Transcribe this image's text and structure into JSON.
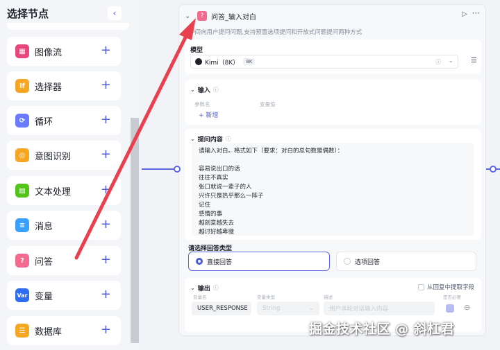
{
  "sidebar": {
    "title": "选择节点",
    "collapse_icon": "chevron-left-icon",
    "items": [
      {
        "label": "图像流",
        "icon": "grid-icon",
        "color": "#e8467c"
      },
      {
        "label": "选择器",
        "icon": "if-icon",
        "color": "#f5a623"
      },
      {
        "label": "循环",
        "icon": "loop-icon",
        "color": "#6b7bff"
      },
      {
        "label": "意图识别",
        "icon": "intent-icon",
        "color": "#f5a623"
      },
      {
        "label": "文本处理",
        "icon": "text-process-icon",
        "color": "#52c41a"
      },
      {
        "label": "消息",
        "icon": "message-icon",
        "color": "#3aa0ff"
      },
      {
        "label": "问答",
        "icon": "question-icon",
        "color": "#f26a8d"
      },
      {
        "label": "变量",
        "icon": "var-icon",
        "color": "#2f6df0"
      },
      {
        "label": "数据库",
        "icon": "database-icon",
        "color": "#f5a623"
      }
    ],
    "add_symbol": "+"
  },
  "node": {
    "title": "问答_输入对白",
    "description": "中间向用户提问问题,支持预置选项提问和开放式问题提问两种方式",
    "model": {
      "label": "模型",
      "name": "Kimi（8K）",
      "tag": "8K"
    },
    "input": {
      "label": "输入",
      "col_name": "参数名",
      "col_value": "变量值",
      "add_label": "+ 新增"
    },
    "prompt": {
      "label": "提问内容",
      "lines": [
        "请输入对白。格式如下（要求：对白的总句数是偶数）：",
        "",
        "容易说出口的话",
        "往往不真实",
        "张口就说一辈子的人",
        "兴许只是热乎那么一阵子",
        "记住",
        "感情的事",
        "越刻意越失去",
        "越讨好越卑微"
      ]
    },
    "answer_type": {
      "label": "请选择回答类型",
      "options": [
        {
          "label": "直接回答",
          "selected": true
        },
        {
          "label": "选项回答",
          "selected": false
        }
      ]
    },
    "output": {
      "label": "输出",
      "extract_label": "从回复中提取字段",
      "col_var": "变量名",
      "col_type": "变量类型",
      "col_desc": "描述",
      "col_required": "是否必要",
      "var_name": "USER_RESPONSE",
      "var_type": "String",
      "desc_placeholder": "用户本轮对话输入内容"
    }
  },
  "watermark": "掘金技术社区 @ 斜杠君",
  "colors": {
    "accent": "#4e5bd6",
    "annotation_arrow": "#e8404f"
  }
}
